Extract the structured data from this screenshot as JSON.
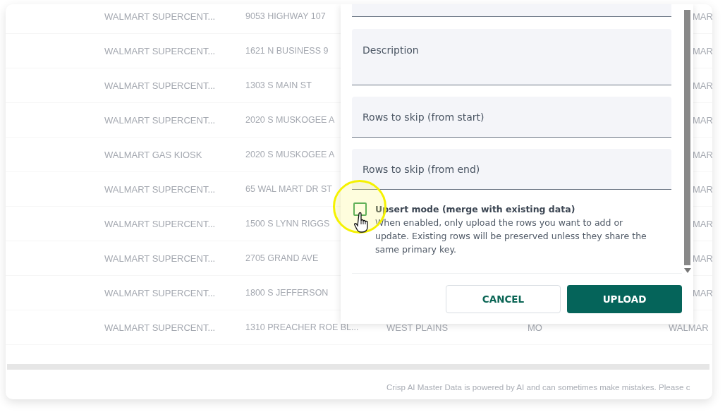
{
  "table": {
    "rows": [
      {
        "name": "WALMART SUPERCENT...",
        "address": "9053 HIGHWAY 107",
        "chain": "MAR"
      },
      {
        "name": "WALMART SUPERCENT...",
        "address": "1621 N BUSINESS 9",
        "chain": "MAR"
      },
      {
        "name": "WALMART SUPERCENT...",
        "address": "1303 S MAIN ST",
        "chain": "MAR"
      },
      {
        "name": "WALMART SUPERCENT...",
        "address": "2020 S MUSKOGEE A",
        "chain": "MAR"
      },
      {
        "name": "WALMART GAS KIOSK",
        "address": "2020 S MUSKOGEE A",
        "chain": "MAR"
      },
      {
        "name": "WALMART SUPERCENT...",
        "address": "65 WAL MART DR ST",
        "chain": "MAR"
      },
      {
        "name": "WALMART SUPERCENT...",
        "address": "1500 S LYNN RIGGS",
        "chain": "MAR"
      },
      {
        "name": "WALMART SUPERCENT...",
        "address": "2705 GRAND AVE",
        "chain": "MAR"
      },
      {
        "name": "WALMART SUPERCENT...",
        "address": "1800 S JEFFERSON",
        "chain": "MAR"
      },
      {
        "name": "WALMART SUPERCENT...",
        "address": "1310 PREACHER ROE BL...",
        "city": "WEST PLAINS",
        "state": "MO",
        "chain": "WALMAR"
      }
    ]
  },
  "dialog": {
    "fields": [
      {
        "label": "Description",
        "kind": "textarea"
      },
      {
        "label": "Rows to skip (from start)",
        "kind": "input"
      },
      {
        "label": "Rows to skip (from end)",
        "kind": "input"
      }
    ],
    "option": {
      "label": "Upsert mode (merge with existing data)",
      "description": "When enabled, only upload the rows you want to add or update. Existing rows will be preserved unless they share the same primary key.",
      "checked": false
    },
    "buttons": [
      {
        "label": "CANCEL",
        "kind": "secondary"
      },
      {
        "label": "UPLOAD",
        "kind": "primary"
      }
    ]
  },
  "footer": {
    "notice": "Crisp AI Master Data is powered by AI and can sometimes make mistakes. Please c"
  }
}
